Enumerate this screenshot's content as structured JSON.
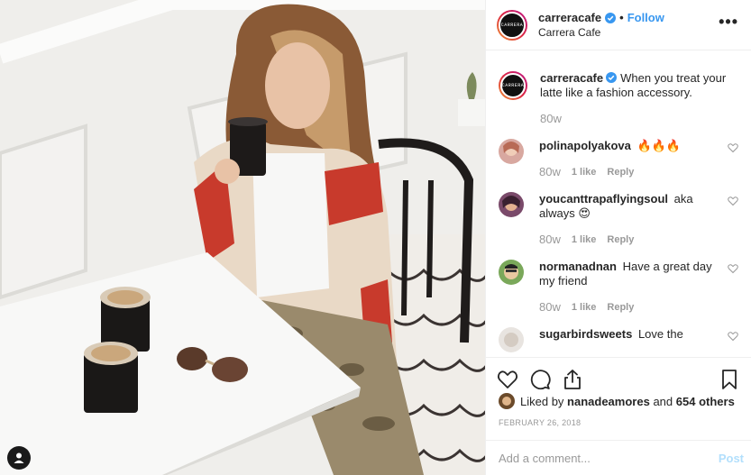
{
  "header": {
    "username": "carreracafe",
    "location": "Carrera Cafe",
    "separator": "•",
    "follow_label": "Follow",
    "more_label": "•••",
    "avatar_text": "CARRERA"
  },
  "caption": {
    "username": "carreracafe",
    "text": "When you treat your latte like a fashion accessory.",
    "time": "80w"
  },
  "comments": [
    {
      "username": "polinapolyakova",
      "text": "🔥🔥🔥",
      "time": "80w",
      "likes": "1 like",
      "reply": "Reply"
    },
    {
      "username": "youcanttrapaflyingsoul",
      "text": "aka always 😍",
      "time": "80w",
      "likes": "1 like",
      "reply": "Reply"
    },
    {
      "username": "normanadnan",
      "text": "Have a great day my friend",
      "time": "80w",
      "likes": "1 like",
      "reply": "Reply"
    },
    {
      "username": "sugarbirdsweets",
      "text": "Love the",
      "time": "",
      "likes": "",
      "reply": ""
    }
  ],
  "likes": {
    "prefix": "Liked by",
    "user": "nanadeamores",
    "middle": "and",
    "others": "654 others"
  },
  "date": "FEBRUARY 26, 2018",
  "add_comment": {
    "placeholder": "Add a comment...",
    "post_label": "Post"
  },
  "colors": {
    "link_blue": "#3897f0",
    "post_disabled": "#b2dffc",
    "muted": "#999999",
    "border": "#efefef"
  },
  "icons": [
    "verified-badge-icon",
    "heart-icon",
    "comment-icon",
    "share-icon",
    "bookmark-icon",
    "user-tag-icon"
  ]
}
